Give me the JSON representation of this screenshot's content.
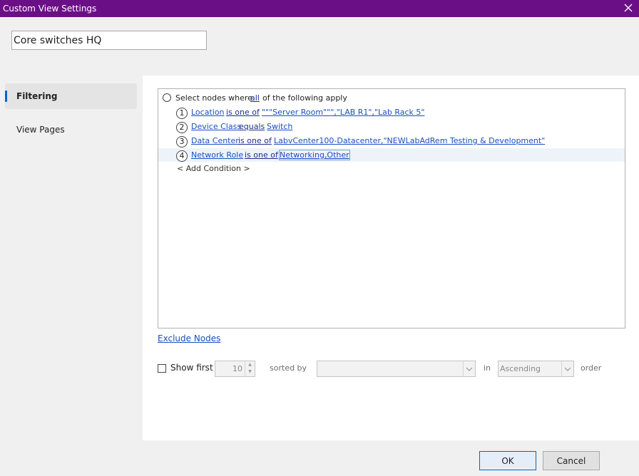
{
  "window": {
    "title": "Custom View Settings"
  },
  "view_name": "Core switches HQ",
  "sidebar": {
    "items": [
      {
        "label": "Filtering",
        "active": true
      },
      {
        "label": "View Pages",
        "active": false
      }
    ]
  },
  "filter": {
    "header": {
      "prefix": "Select nodes where",
      "quantifier": "all",
      "suffix": "of the following apply"
    },
    "conditions": [
      {
        "num": "1",
        "field": "Location",
        "op": "is one of",
        "value": "\"\"\"Server Room\"\"\",\"LAB R1\",\"Lab Rack 5\""
      },
      {
        "num": "2",
        "field": "Device Class",
        "op": "equals",
        "value": "Switch"
      },
      {
        "num": "3",
        "field": "Data Center",
        "op": "is one of",
        "value": "LabvCenter100-Datacenter,\"NEWLabAdRem Testing & Development\""
      },
      {
        "num": "4",
        "field": "Network Role",
        "op": "is one of",
        "value": "Networking,Other"
      }
    ],
    "add_condition": "< Add Condition >"
  },
  "exclude_nodes": "Exclude Nodes",
  "limit": {
    "show_first_label": "Show first",
    "show_first_value": "10",
    "sorted_by_label": "sorted by",
    "sorted_by_value": "",
    "in_label": "in",
    "order_value": "Ascending",
    "order_label": "order"
  },
  "buttons": {
    "ok": "OK",
    "cancel": "Cancel"
  },
  "colors": {
    "title_bar": "#6b0f86",
    "link": "#1a4ec0",
    "accent": "#0067c0"
  }
}
